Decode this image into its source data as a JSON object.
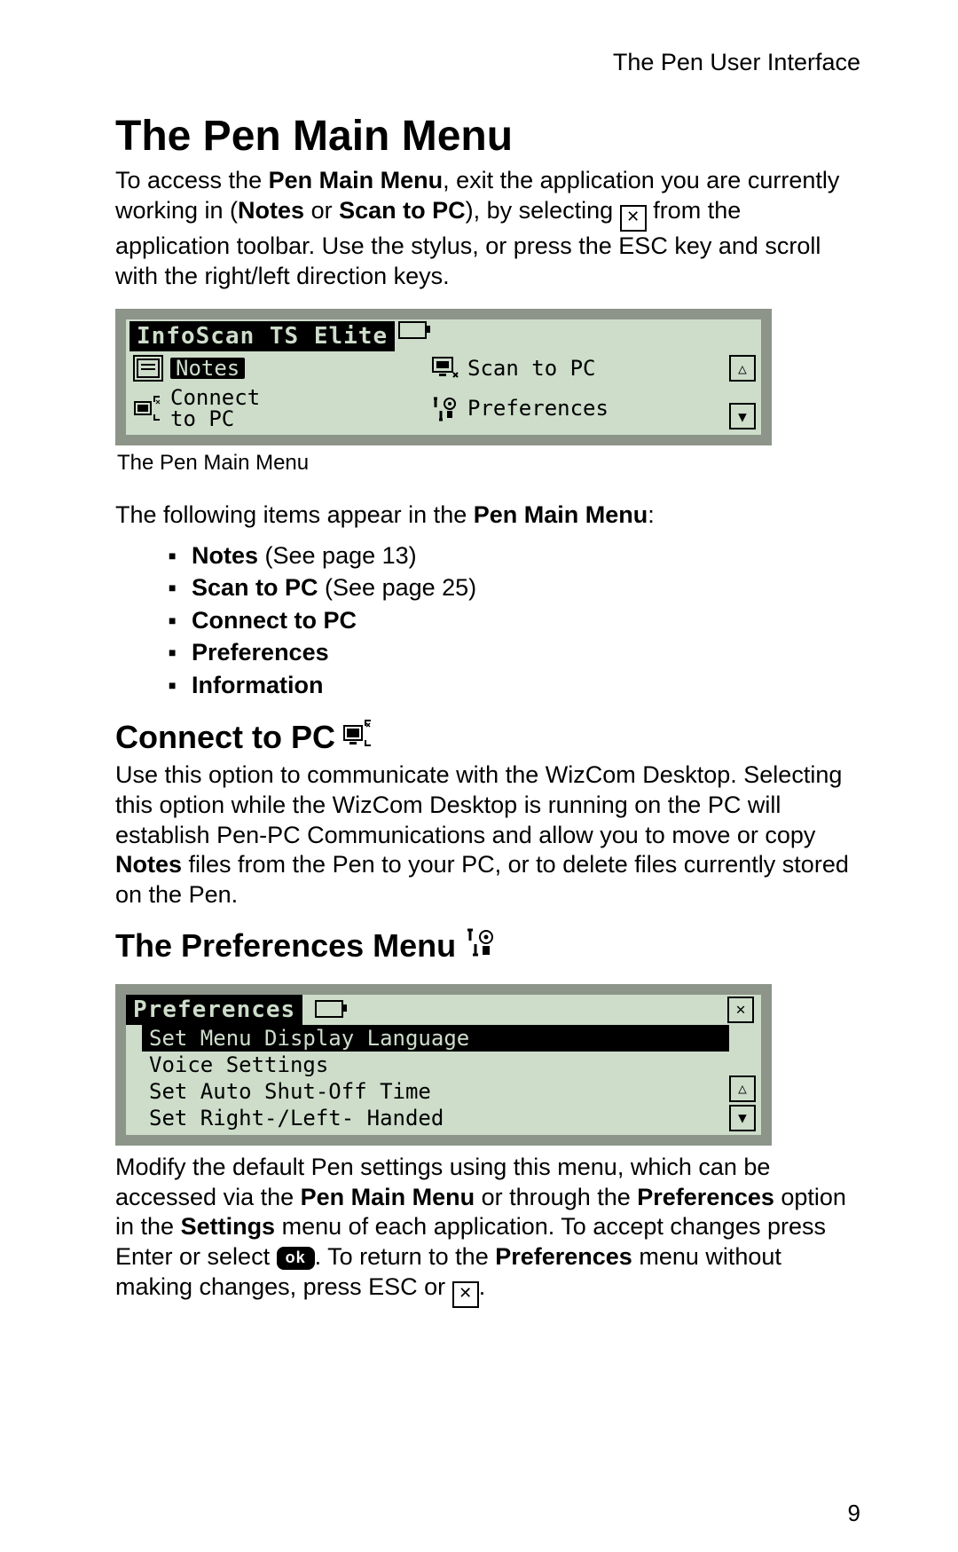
{
  "header": "The Pen User Interface",
  "title": "The Pen Main Menu",
  "intro": {
    "t1a": "To access the ",
    "t1b": "Pen Main Menu",
    "t1c": ", exit the application you are currently working in (",
    "t1d": "Notes",
    "t1e": " or ",
    "t1f": "Scan to PC",
    "t1g": "), by selecting ",
    "t1h": " from the application toolbar. Use the stylus, or press the ESC key and scroll with the right/left direction keys."
  },
  "lcd1": {
    "title": "InfoScan TS Elite",
    "notes": "Notes",
    "scan": "Scan to PC",
    "connect_l1": "Connect",
    "connect_l2": "to PC",
    "prefs": "Preferences"
  },
  "caption1": "The Pen Main Menu",
  "midline_a": "The following items appear in the ",
  "midline_b": "Pen Main Menu",
  "midline_c": ":",
  "items": [
    {
      "bold": "Notes",
      "rest": " (See page 13)"
    },
    {
      "bold": "Scan to PC",
      "rest": " (See page 25)"
    },
    {
      "bold": "Connect to PC",
      "rest": ""
    },
    {
      "bold": "Preferences",
      "rest": ""
    },
    {
      "bold": "Information",
      "rest": ""
    }
  ],
  "section_connect": {
    "title": "Connect to PC",
    "body_a": "Use this option to communicate with the WizCom Desktop. Selecting this option while the WizCom Desktop is running on the PC will establish Pen-PC Communications and allow you to move or copy ",
    "body_b": "Notes",
    "body_c": " files from the Pen to your PC, or to delete files currently stored on the Pen."
  },
  "section_prefs": {
    "title": "The Preferences Menu"
  },
  "lcd2": {
    "title": "Preferences",
    "items": [
      "Set Menu Display Language",
      "Voice Settings",
      "Set Auto Shut-Off Time",
      "Set Right-/Left- Handed"
    ],
    "selected_index": 0
  },
  "prefs_body": {
    "a": "Modify the default Pen settings using this menu, which can be accessed via the ",
    "b": "Pen Main Menu",
    "c": " or through the ",
    "d": "Preferences",
    "e": " option in the ",
    "f": "Settings",
    "g": " menu of each application. To accept changes press Enter or select ",
    "h": ". To return to the ",
    "i": "Preferences",
    "j": " menu without making changes, press ESC or ",
    "k": "."
  },
  "ok_label": "ok",
  "page_number": "9"
}
